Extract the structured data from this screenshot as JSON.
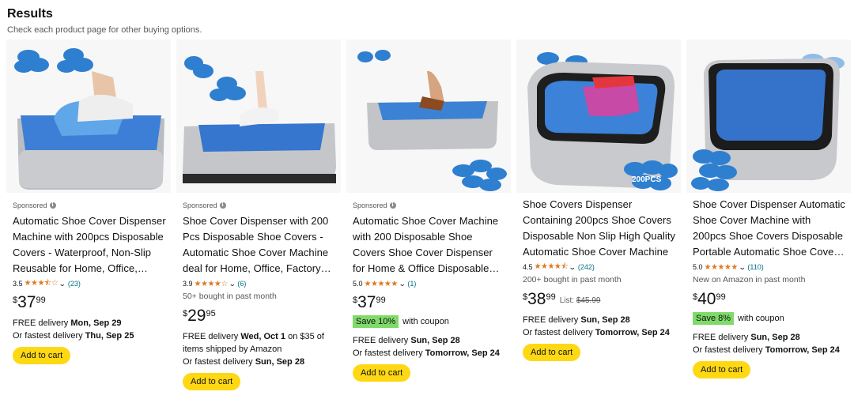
{
  "header": {
    "title": "Results",
    "subtitle": "Check each product page for other buying options."
  },
  "colors": {
    "star": "#DE7921",
    "link": "#007185",
    "cart_button": "#FFD814",
    "coupon_badge": "#7FDA69"
  },
  "products": [
    {
      "sponsored": "Sponsored",
      "title": "Automatic Shoe Cover Dispenser Machine with 200pcs Disposable Covers - Waterproof, Non-Slip Reusable for Home, Office, Laboratory",
      "rating": "3.5",
      "stars": 3.5,
      "rating_count": "(23)",
      "bought": "",
      "price_currency": "$",
      "price_whole": "37",
      "price_fraction": "99",
      "list_label": "",
      "list_price": "",
      "coupon_badge": "",
      "coupon_text": "",
      "delivery_prefix": "FREE delivery ",
      "delivery_date": "Mon, Sep 29",
      "delivery_suffix": "",
      "fastest_prefix": "Or fastest delivery ",
      "fastest_date": "Thu, Sep 25",
      "cart_label": "Add to cart"
    },
    {
      "sponsored": "Sponsored",
      "title": "Shoe Cover Dispenser with 200 Pcs Disposable Shoe Covers - Automatic Shoe Cover Machine deal for Home, Office, Factory and Lab",
      "rating": "3.9",
      "stars": 4,
      "rating_count": "(6)",
      "bought": "50+ bought in past month",
      "price_currency": "$",
      "price_whole": "29",
      "price_fraction": "95",
      "list_label": "",
      "list_price": "",
      "coupon_badge": "",
      "coupon_text": "",
      "delivery_prefix": "FREE delivery ",
      "delivery_date": "Wed, Oct 1",
      "delivery_suffix": " on $35 of items shipped by Amazon",
      "fastest_prefix": "Or fastest delivery ",
      "fastest_date": "Sun, Sep 28",
      "cart_label": "Add to cart"
    },
    {
      "sponsored": "Sponsored",
      "title": "Automatic Shoe Cover Machine with 200 Disposable Shoe Covers Shoe Cover Dispenser for Home & Office Disposable Non Slip",
      "rating": "5.0",
      "stars": 5,
      "rating_count": "(1)",
      "bought": "",
      "price_currency": "$",
      "price_whole": "37",
      "price_fraction": "99",
      "list_label": "",
      "list_price": "",
      "coupon_badge": "Save 10%",
      "coupon_text": "with coupon",
      "delivery_prefix": "FREE delivery ",
      "delivery_date": "Sun, Sep 28",
      "delivery_suffix": "",
      "fastest_prefix": "Or fastest delivery ",
      "fastest_date": "Tomorrow, Sep 24",
      "cart_label": "Add to cart"
    },
    {
      "sponsored": "",
      "title": "Shoe Covers Dispenser Containing 200pcs Shoe Covers Disposable Non Slip High Quality Automatic Shoe Cover Machine",
      "rating": "4.5",
      "stars": 4.5,
      "rating_count": "(242)",
      "bought": "200+ bought in past month",
      "price_currency": "$",
      "price_whole": "38",
      "price_fraction": "99",
      "list_label": "List: ",
      "list_price": "$45.99",
      "coupon_badge": "",
      "coupon_text": "",
      "delivery_prefix": "FREE delivery ",
      "delivery_date": "Sun, Sep 28",
      "delivery_suffix": "",
      "fastest_prefix": "Or fastest delivery ",
      "fastest_date": "Tomorrow, Sep 24",
      "cart_label": "Add to cart",
      "image_text": "200PCS"
    },
    {
      "sponsored": "",
      "title": "Shoe Cover Dispenser Automatic Shoe Cover Machine with 200pcs Shoe Covers Disposable Portable Automatic Shoe Cover Dispenser",
      "rating": "5.0",
      "stars": 5,
      "rating_count": "(110)",
      "bought": "New on Amazon in past month",
      "price_currency": "$",
      "price_whole": "40",
      "price_fraction": "99",
      "list_label": "",
      "list_price": "",
      "coupon_badge": "Save 8%",
      "coupon_text": "with coupon",
      "delivery_prefix": "FREE delivery ",
      "delivery_date": "Sun, Sep 28",
      "delivery_suffix": "",
      "fastest_prefix": "Or fastest delivery ",
      "fastest_date": "Tomorrow, Sep 24",
      "cart_label": "Add to cart"
    }
  ]
}
